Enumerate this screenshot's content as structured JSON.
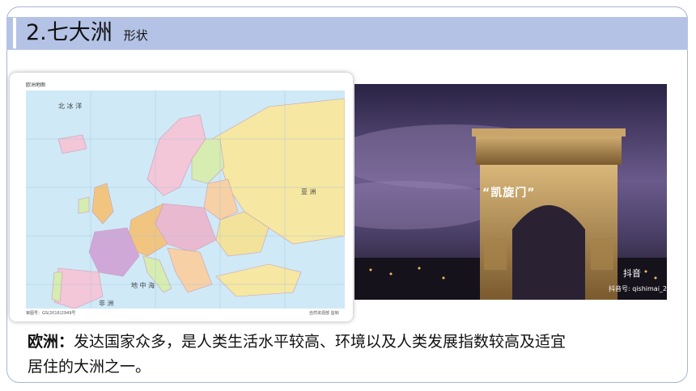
{
  "header": {
    "title": "2.七大洲",
    "subtitle": "形状"
  },
  "map": {
    "title": "欧洲地图",
    "label_sea": "北 冰 洋",
    "label_med": "地 中 海",
    "label_africa": "非 洲",
    "label_asia": "亚 洲",
    "footer_left": "审图号：GS(2016)2949号",
    "footer_right": "自然资源部 监制"
  },
  "photo": {
    "caption": "“凯旋门”",
    "logo_text": "抖音",
    "account": "抖音号: qishimai_2"
  },
  "body": {
    "keyword": "欧洲：",
    "line1": "发达国家众多，是人类生活水平较高、环境以及人类发展指数较高及适宜",
    "line2": "居住的大洲之一。"
  }
}
